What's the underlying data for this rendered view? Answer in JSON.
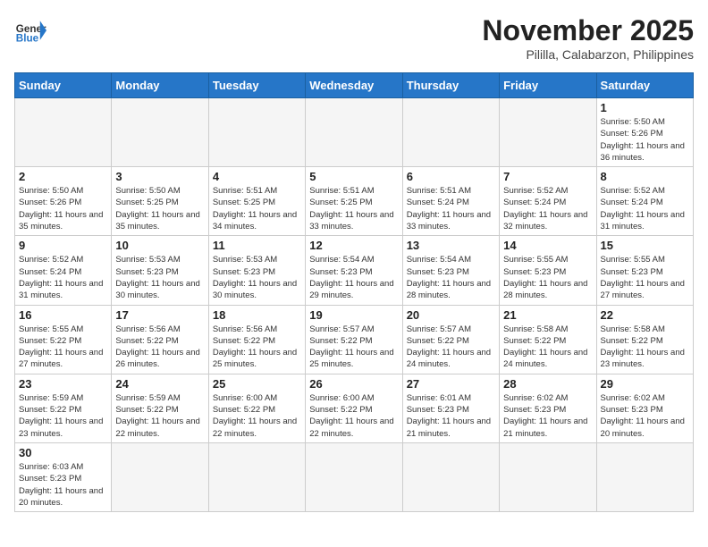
{
  "header": {
    "logo_general": "General",
    "logo_blue": "Blue",
    "month": "November 2025",
    "location": "Pililla, Calabarzon, Philippines"
  },
  "weekdays": [
    "Sunday",
    "Monday",
    "Tuesday",
    "Wednesday",
    "Thursday",
    "Friday",
    "Saturday"
  ],
  "weeks": [
    [
      {
        "day": "",
        "empty": true
      },
      {
        "day": "",
        "empty": true
      },
      {
        "day": "",
        "empty": true
      },
      {
        "day": "",
        "empty": true
      },
      {
        "day": "",
        "empty": true
      },
      {
        "day": "",
        "empty": true
      },
      {
        "day": "1",
        "sunrise": "5:50 AM",
        "sunset": "5:26 PM",
        "daylight": "11 hours and 36 minutes."
      }
    ],
    [
      {
        "day": "2",
        "sunrise": "5:50 AM",
        "sunset": "5:26 PM",
        "daylight": "11 hours and 35 minutes."
      },
      {
        "day": "3",
        "sunrise": "5:50 AM",
        "sunset": "5:25 PM",
        "daylight": "11 hours and 35 minutes."
      },
      {
        "day": "4",
        "sunrise": "5:51 AM",
        "sunset": "5:25 PM",
        "daylight": "11 hours and 34 minutes."
      },
      {
        "day": "5",
        "sunrise": "5:51 AM",
        "sunset": "5:25 PM",
        "daylight": "11 hours and 33 minutes."
      },
      {
        "day": "6",
        "sunrise": "5:51 AM",
        "sunset": "5:24 PM",
        "daylight": "11 hours and 33 minutes."
      },
      {
        "day": "7",
        "sunrise": "5:52 AM",
        "sunset": "5:24 PM",
        "daylight": "11 hours and 32 minutes."
      },
      {
        "day": "8",
        "sunrise": "5:52 AM",
        "sunset": "5:24 PM",
        "daylight": "11 hours and 31 minutes."
      }
    ],
    [
      {
        "day": "9",
        "sunrise": "5:52 AM",
        "sunset": "5:24 PM",
        "daylight": "11 hours and 31 minutes."
      },
      {
        "day": "10",
        "sunrise": "5:53 AM",
        "sunset": "5:23 PM",
        "daylight": "11 hours and 30 minutes."
      },
      {
        "day": "11",
        "sunrise": "5:53 AM",
        "sunset": "5:23 PM",
        "daylight": "11 hours and 30 minutes."
      },
      {
        "day": "12",
        "sunrise": "5:54 AM",
        "sunset": "5:23 PM",
        "daylight": "11 hours and 29 minutes."
      },
      {
        "day": "13",
        "sunrise": "5:54 AM",
        "sunset": "5:23 PM",
        "daylight": "11 hours and 28 minutes."
      },
      {
        "day": "14",
        "sunrise": "5:55 AM",
        "sunset": "5:23 PM",
        "daylight": "11 hours and 28 minutes."
      },
      {
        "day": "15",
        "sunrise": "5:55 AM",
        "sunset": "5:23 PM",
        "daylight": "11 hours and 27 minutes."
      }
    ],
    [
      {
        "day": "16",
        "sunrise": "5:55 AM",
        "sunset": "5:22 PM",
        "daylight": "11 hours and 27 minutes."
      },
      {
        "day": "17",
        "sunrise": "5:56 AM",
        "sunset": "5:22 PM",
        "daylight": "11 hours and 26 minutes."
      },
      {
        "day": "18",
        "sunrise": "5:56 AM",
        "sunset": "5:22 PM",
        "daylight": "11 hours and 25 minutes."
      },
      {
        "day": "19",
        "sunrise": "5:57 AM",
        "sunset": "5:22 PM",
        "daylight": "11 hours and 25 minutes."
      },
      {
        "day": "20",
        "sunrise": "5:57 AM",
        "sunset": "5:22 PM",
        "daylight": "11 hours and 24 minutes."
      },
      {
        "day": "21",
        "sunrise": "5:58 AM",
        "sunset": "5:22 PM",
        "daylight": "11 hours and 24 minutes."
      },
      {
        "day": "22",
        "sunrise": "5:58 AM",
        "sunset": "5:22 PM",
        "daylight": "11 hours and 23 minutes."
      }
    ],
    [
      {
        "day": "23",
        "sunrise": "5:59 AM",
        "sunset": "5:22 PM",
        "daylight": "11 hours and 23 minutes."
      },
      {
        "day": "24",
        "sunrise": "5:59 AM",
        "sunset": "5:22 PM",
        "daylight": "11 hours and 22 minutes."
      },
      {
        "day": "25",
        "sunrise": "6:00 AM",
        "sunset": "5:22 PM",
        "daylight": "11 hours and 22 minutes."
      },
      {
        "day": "26",
        "sunrise": "6:00 AM",
        "sunset": "5:22 PM",
        "daylight": "11 hours and 22 minutes."
      },
      {
        "day": "27",
        "sunrise": "6:01 AM",
        "sunset": "5:23 PM",
        "daylight": "11 hours and 21 minutes."
      },
      {
        "day": "28",
        "sunrise": "6:02 AM",
        "sunset": "5:23 PM",
        "daylight": "11 hours and 21 minutes."
      },
      {
        "day": "29",
        "sunrise": "6:02 AM",
        "sunset": "5:23 PM",
        "daylight": "11 hours and 20 minutes."
      }
    ],
    [
      {
        "day": "30",
        "sunrise": "6:03 AM",
        "sunset": "5:23 PM",
        "daylight": "11 hours and 20 minutes."
      },
      {
        "day": "",
        "empty": true
      },
      {
        "day": "",
        "empty": true
      },
      {
        "day": "",
        "empty": true
      },
      {
        "day": "",
        "empty": true
      },
      {
        "day": "",
        "empty": true
      },
      {
        "day": "",
        "empty": true
      }
    ]
  ]
}
